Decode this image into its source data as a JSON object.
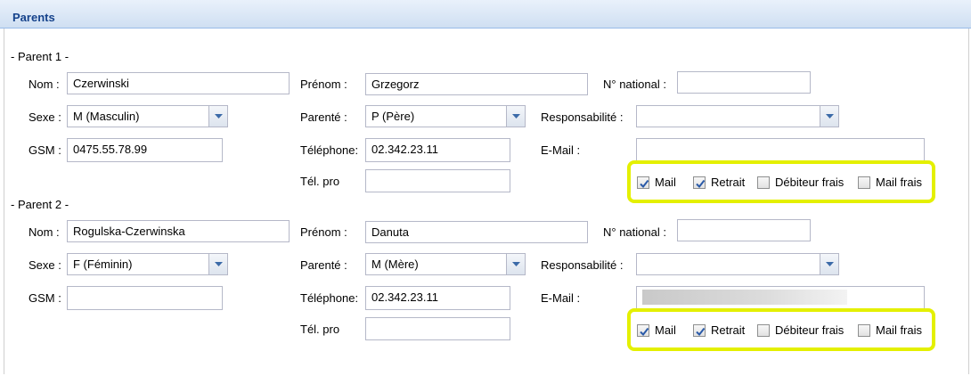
{
  "panel": {
    "title": "Parents"
  },
  "labels": {
    "nom": "Nom :",
    "prenom": "Prénom :",
    "national": "N° national :",
    "sexe": "Sexe :",
    "parente": "Parenté :",
    "responsabilite": "Responsabilité :",
    "gsm": "GSM :",
    "telephone": "Téléphone:",
    "email": "E-Mail :",
    "telpro": "Tél. pro"
  },
  "checkboxes": {
    "mail": "Mail",
    "retrait": "Retrait",
    "debiteur": "Débiteur frais",
    "mailfrais": "Mail frais"
  },
  "parents": [
    {
      "heading": "- Parent 1 -",
      "nom": "Czerwinski",
      "prenom": "Grzegorz",
      "national": "",
      "sexe": "M (Masculin)",
      "parente": "P (Père)",
      "responsabilite": "",
      "gsm": "0475.55.78.99",
      "telephone": "02.342.23.11",
      "email": "",
      "email_obscured": false,
      "telpro": "",
      "mail_checked": true,
      "retrait_checked": true,
      "debiteur_checked": false,
      "mailfrais_checked": false
    },
    {
      "heading": "- Parent 2 -",
      "nom": "Rogulska-Czerwinska",
      "prenom": "Danuta",
      "national": "",
      "sexe": "F (Féminin)",
      "parente": "M (Mère)",
      "responsabilite": "",
      "gsm": "",
      "telephone": "02.342.23.11",
      "email": "",
      "email_obscured": true,
      "telpro": "",
      "mail_checked": true,
      "retrait_checked": true,
      "debiteur_checked": false,
      "mailfrais_checked": false
    }
  ]
}
